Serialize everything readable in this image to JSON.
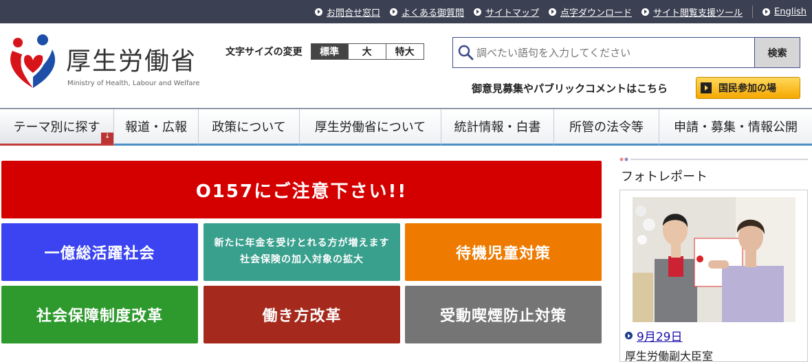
{
  "topbar": {
    "links": [
      {
        "label": "お問合せ窓口"
      },
      {
        "label": "よくある御質問"
      },
      {
        "label": "サイトマップ"
      },
      {
        "label": "点字ダウンロード"
      },
      {
        "label": "サイト閲覧支援ツール"
      },
      {
        "label": "English"
      }
    ]
  },
  "logo": {
    "title": "厚生労働省",
    "subtitle": "Ministry of Health, Labour and Welfare"
  },
  "font_size": {
    "label": "文字サイズの変更",
    "options": [
      "標準",
      "大",
      "特大"
    ],
    "selected": "標準"
  },
  "search": {
    "placeholder": "調べたい語句を入力してください",
    "button": "検索"
  },
  "public_comment": {
    "text": "御意見募集やパブリックコメントはこちら",
    "button": "国民参加の場"
  },
  "gnav": {
    "items": [
      {
        "label": "テーマ別に探す"
      },
      {
        "label": "報道・広報"
      },
      {
        "label": "政策について"
      },
      {
        "label": "厚生労働省について"
      },
      {
        "label": "統計情報・白書"
      },
      {
        "label": "所管の法令等"
      },
      {
        "label": "申請・募集・情報公開"
      }
    ]
  },
  "banners": {
    "top": {
      "label": "O157にご注意下さい!!",
      "color": "#d40000"
    },
    "grid": [
      {
        "label": "一億総活躍社会",
        "color": "#3b44f0"
      },
      {
        "line1": "新たに年金を受けとれる方が増えます",
        "line2": "社会保険の加入対象の拡大",
        "color": "#3aa08e"
      },
      {
        "label": "待機児童対策",
        "color": "#ee7a00"
      },
      {
        "label": "社会保障制度改革",
        "color": "#2e9a2e"
      },
      {
        "label": "働き方改革",
        "color": "#a5291c"
      },
      {
        "label": "受動喫煙防止対策",
        "color": "#757575"
      }
    ]
  },
  "photo_report": {
    "title": "フォトレポート",
    "date": "9月29日",
    "caption": "厚生労働副大臣室"
  }
}
